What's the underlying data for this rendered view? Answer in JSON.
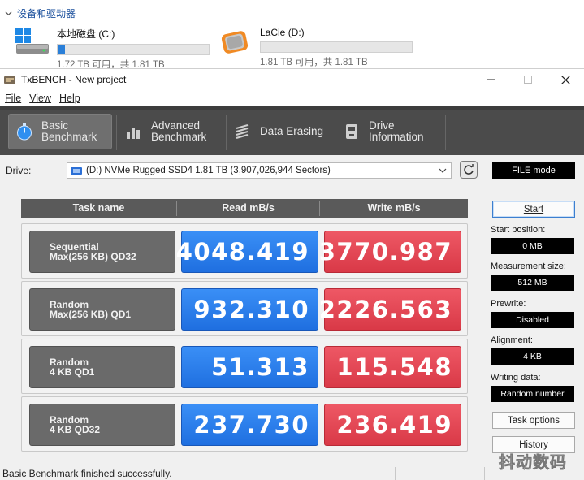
{
  "explorer": {
    "group_title": "设备和驱动器",
    "drives": [
      {
        "name": "本地磁盘 (C:)",
        "size": "1.72 TB 可用，共 1.81 TB",
        "fill": 0.05
      },
      {
        "name": "LaCie (D:)",
        "size": "1.81 TB 可用，共 1.81 TB",
        "fill": 0.0
      }
    ]
  },
  "window": {
    "title": "TxBENCH - New project",
    "menu": [
      "File",
      "View",
      "Help"
    ]
  },
  "tabs": [
    {
      "line1": "Basic",
      "line2": "Benchmark",
      "icon": "stopwatch-icon",
      "active": true
    },
    {
      "line1": "Advanced",
      "line2": "Benchmark",
      "icon": "bar-chart-icon",
      "active": false
    },
    {
      "line1": "Data Erasing",
      "line2": "",
      "icon": "eraser-icon",
      "active": false
    },
    {
      "line1": "Drive",
      "line2": "Information",
      "icon": "drive-info-icon",
      "active": false
    }
  ],
  "drive_select": {
    "label": "Drive:",
    "value": "(D:) NVMe Rugged SSD4  1.81 TB (3,907,026,944 Sectors)",
    "mode": "FILE mode"
  },
  "table": {
    "headers": [
      "Task name",
      "Read mB/s",
      "Write mB/s"
    ],
    "rows": [
      {
        "line1": "Sequential",
        "line2": "Max(256 KB) QD32",
        "read": "4048.419",
        "write": "3770.987"
      },
      {
        "line1": "Random",
        "line2": "Max(256 KB) QD1",
        "read": "932.310",
        "write": "2226.563"
      },
      {
        "line1": "Random",
        "line2": "4 KB QD1",
        "read": "51.313",
        "write": "115.548"
      },
      {
        "line1": "Random",
        "line2": "4 KB QD32",
        "read": "237.730",
        "write": "236.419"
      }
    ]
  },
  "side": {
    "start": "Start",
    "start_position_label": "Start position:",
    "start_position": "0 MB",
    "measurement_size_label": "Measurement size:",
    "measurement_size": "512 MB",
    "prewrite_label": "Prewrite:",
    "prewrite": "Disabled",
    "alignment_label": "Alignment:",
    "alignment": "4 KB",
    "writing_data_label": "Writing data:",
    "writing_data": "Random number",
    "task_options": "Task options",
    "history": "History"
  },
  "status": "Basic Benchmark finished successfully.",
  "watermark": "抖动数码",
  "colors": {
    "read": "#2a7ef0",
    "write": "#e2464f",
    "toolbar": "#4b4b4b"
  }
}
